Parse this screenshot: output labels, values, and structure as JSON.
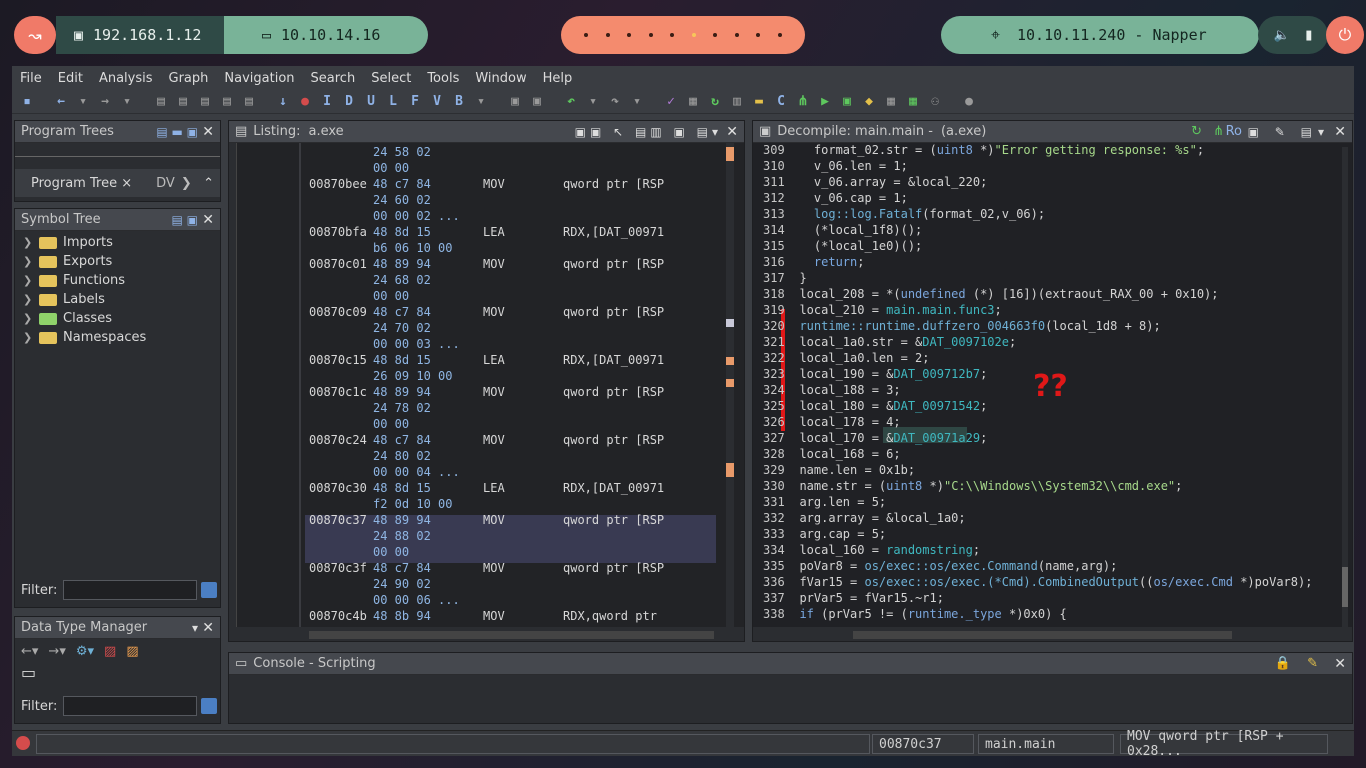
{
  "taskbar": {
    "ip_local": "192.168.1.12",
    "ip_vpn": "10.10.14.16",
    "workspaces": [
      "",
      "",
      "",
      "",
      "",
      "",
      "",
      "",
      "",
      ""
    ],
    "active_workspace": 5,
    "target": "10.10.11.240 - Napper"
  },
  "menu": [
    "File",
    "Edit",
    "Analysis",
    "Graph",
    "Navigation",
    "Search",
    "Select",
    "Tools",
    "Window",
    "Help"
  ],
  "panels": {
    "program_trees": {
      "title": "Program Trees",
      "tab_label": "Program Tree",
      "tab_close": "×",
      "dv": "DV"
    },
    "symbol_tree": {
      "title": "Symbol Tree",
      "items": [
        "Imports",
        "Exports",
        "Functions",
        "Labels",
        "Classes",
        "Namespaces"
      ]
    },
    "filter_label": "Filter:",
    "data_type_manager": {
      "title": "Data Type Manager",
      "filter_label": "Filter:"
    },
    "listing": {
      "title": "Listing:",
      "file": "a.exe"
    },
    "decompile": {
      "title": "Decompile: main.main -",
      "file": "(a.exe)",
      "ro": "Ro"
    },
    "console": {
      "title": "Console - Scripting"
    }
  },
  "listing_rows": [
    {
      "addr": "",
      "bytes": "24 58 02",
      "mnem": "",
      "ops": ""
    },
    {
      "addr": "",
      "bytes": "00 00",
      "mnem": "",
      "ops": ""
    },
    {
      "addr": "00870bee",
      "bytes": "48 c7 84",
      "mnem": "MOV",
      "ops": "qword ptr [RSP"
    },
    {
      "addr": "",
      "bytes": "24 60 02",
      "mnem": "",
      "ops": ""
    },
    {
      "addr": "",
      "bytes": "00 00 02 ...",
      "mnem": "",
      "ops": ""
    },
    {
      "addr": "00870bfa",
      "bytes": "48 8d 15",
      "mnem": "LEA",
      "ops": "RDX,[DAT_00971"
    },
    {
      "addr": "",
      "bytes": "b6 06 10 00",
      "mnem": "",
      "ops": ""
    },
    {
      "addr": "00870c01",
      "bytes": "48 89 94",
      "mnem": "MOV",
      "ops": "qword ptr [RSP"
    },
    {
      "addr": "",
      "bytes": "24 68 02",
      "mnem": "",
      "ops": ""
    },
    {
      "addr": "",
      "bytes": "00 00",
      "mnem": "",
      "ops": ""
    },
    {
      "addr": "00870c09",
      "bytes": "48 c7 84",
      "mnem": "MOV",
      "ops": "qword ptr [RSP"
    },
    {
      "addr": "",
      "bytes": "24 70 02",
      "mnem": "",
      "ops": ""
    },
    {
      "addr": "",
      "bytes": "00 00 03 ...",
      "mnem": "",
      "ops": ""
    },
    {
      "addr": "00870c15",
      "bytes": "48 8d 15",
      "mnem": "LEA",
      "ops": "RDX,[DAT_00971"
    },
    {
      "addr": "",
      "bytes": "26 09 10 00",
      "mnem": "",
      "ops": ""
    },
    {
      "addr": "00870c1c",
      "bytes": "48 89 94",
      "mnem": "MOV",
      "ops": "qword ptr [RSP"
    },
    {
      "addr": "",
      "bytes": "24 78 02",
      "mnem": "",
      "ops": ""
    },
    {
      "addr": "",
      "bytes": "00 00",
      "mnem": "",
      "ops": ""
    },
    {
      "addr": "00870c24",
      "bytes": "48 c7 84",
      "mnem": "MOV",
      "ops": "qword ptr [RSP"
    },
    {
      "addr": "",
      "bytes": "24 80 02",
      "mnem": "",
      "ops": ""
    },
    {
      "addr": "",
      "bytes": "00 00 04 ...",
      "mnem": "",
      "ops": ""
    },
    {
      "addr": "00870c30",
      "bytes": "48 8d 15",
      "mnem": "LEA",
      "ops": "RDX,[DAT_00971"
    },
    {
      "addr": "",
      "bytes": "f2 0d 10 00",
      "mnem": "",
      "ops": ""
    },
    {
      "addr": "00870c37",
      "bytes": "48 89 94",
      "mnem": "MOV",
      "ops": "qword ptr [RSP"
    },
    {
      "addr": "",
      "bytes": "24 88 02",
      "mnem": "",
      "ops": ""
    },
    {
      "addr": "",
      "bytes": "00 00",
      "mnem": "",
      "ops": ""
    },
    {
      "addr": "00870c3f",
      "bytes": "48 c7 84",
      "mnem": "MOV",
      "ops": "qword ptr [RSP"
    },
    {
      "addr": "",
      "bytes": "24 90 02",
      "mnem": "",
      "ops": ""
    },
    {
      "addr": "",
      "bytes": "00 00 06 ...",
      "mnem": "",
      "ops": ""
    },
    {
      "addr": "00870c4b",
      "bytes": "48 8b 94",
      "mnem": "MOV",
      "ops": "RDX,qword ptr"
    }
  ],
  "decompile_lines": [
    {
      "n": "309",
      "code": "    format_02.str = (uint8 *)\"Error getting response: %s\";"
    },
    {
      "n": "310",
      "code": "    v_06.len = 1;"
    },
    {
      "n": "311",
      "code": "    v_06.array = &local_220;"
    },
    {
      "n": "312",
      "code": "    v_06.cap = 1;"
    },
    {
      "n": "313",
      "code": "    log::log.Fatalf(format_02,v_06);"
    },
    {
      "n": "314",
      "code": "    (*local_1f8)();"
    },
    {
      "n": "315",
      "code": "    (*local_1e0)();"
    },
    {
      "n": "316",
      "code": "    return;"
    },
    {
      "n": "317",
      "code": "  }"
    },
    {
      "n": "318",
      "code": "  local_208 = *(undefined (*) [16])(extraout_RAX_00 + 0x10);"
    },
    {
      "n": "319",
      "code": "  local_210 = main.main.func3;"
    },
    {
      "n": "320",
      "code": "  runtime::runtime.duffzero_004663f0(local_1d8 + 8);"
    },
    {
      "n": "321",
      "code": "  local_1a0.str = &DAT_0097102e;"
    },
    {
      "n": "322",
      "code": "  local_1a0.len = 2;"
    },
    {
      "n": "323",
      "code": "  local_190 = &DAT_009712b7;"
    },
    {
      "n": "324",
      "code": "  local_188 = 3;"
    },
    {
      "n": "325",
      "code": "  local_180 = &DAT_00971542;"
    },
    {
      "n": "326",
      "code": "  local_178 = 4;"
    },
    {
      "n": "327",
      "code": "  local_170 = &DAT_00971a29;"
    },
    {
      "n": "328",
      "code": "  local_168 = 6;"
    },
    {
      "n": "329",
      "code": "  name.len = 0x1b;"
    },
    {
      "n": "330",
      "code": "  name.str = (uint8 *)\"C:\\\\Windows\\\\System32\\\\cmd.exe\";"
    },
    {
      "n": "331",
      "code": "  arg.len = 5;"
    },
    {
      "n": "332",
      "code": "  arg.array = &local_1a0;"
    },
    {
      "n": "333",
      "code": "  arg.cap = 5;"
    },
    {
      "n": "334",
      "code": "  local_160 = randomstring;"
    },
    {
      "n": "335",
      "code": "  poVar8 = os/exec::os/exec.Command(name,arg);"
    },
    {
      "n": "336",
      "code": "  fVar15 = os/exec::os/exec.(*Cmd).CombinedOutput((os/exec.Cmd *)poVar8);"
    },
    {
      "n": "337",
      "code": "  prVar5 = fVar15.~r1;"
    },
    {
      "n": "338",
      "code": "  if (prVar5 != (runtime._type *)0x0) {"
    }
  ],
  "annotation": "??",
  "status": {
    "address": "00870c37",
    "function": "main.main",
    "instruction": "MOV qword ptr [RSP + 0x28..."
  }
}
